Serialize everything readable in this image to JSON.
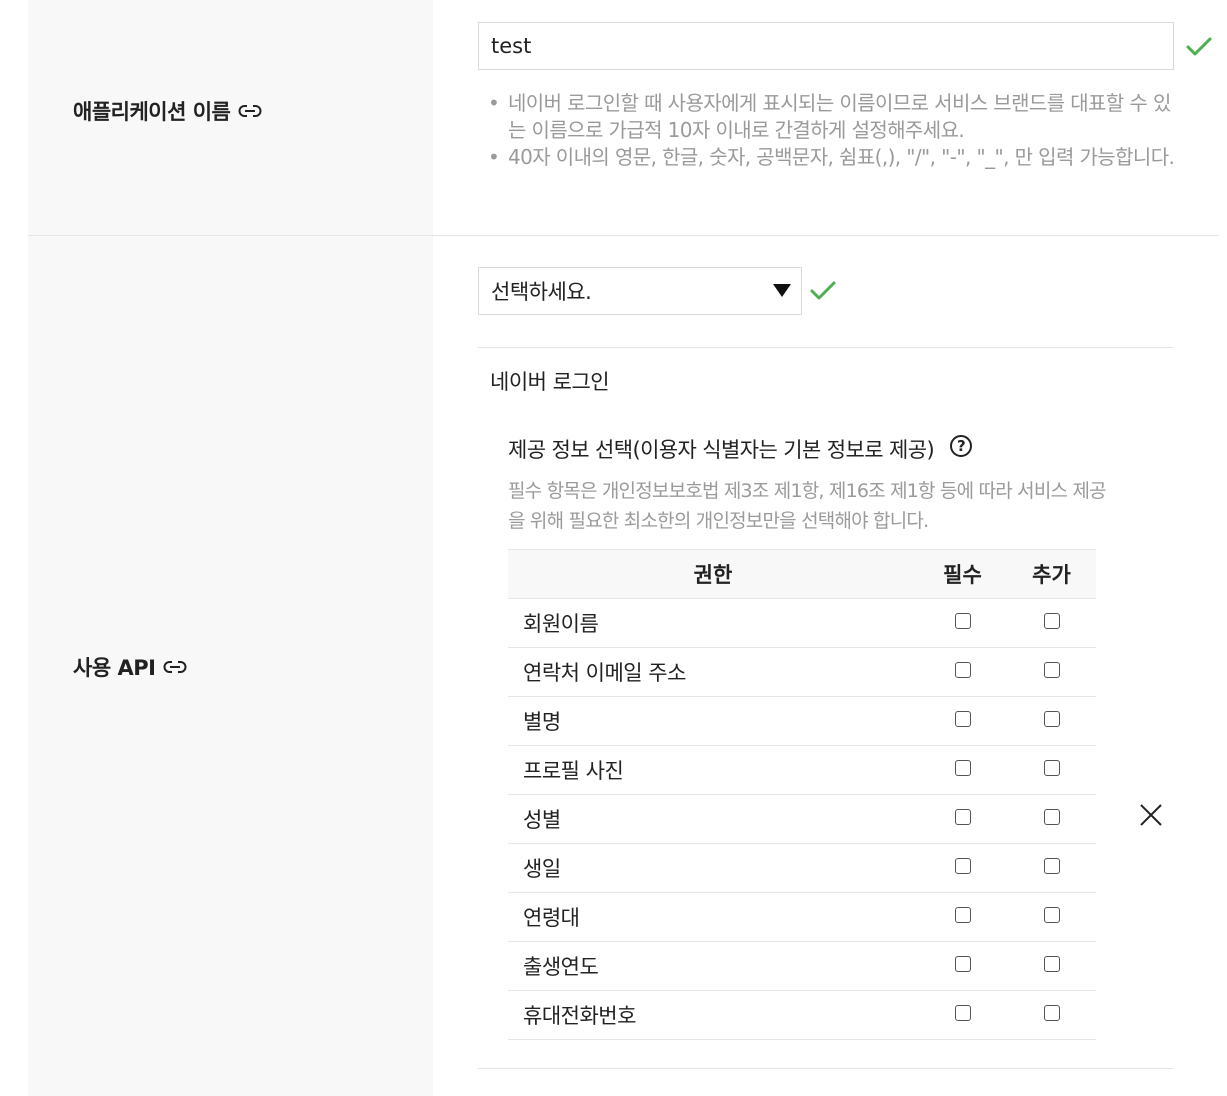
{
  "app_name_section": {
    "label": "애플리케이션 이름",
    "input_value": "test",
    "help": [
      "네이버 로그인할 때 사용자에게 표시되는 이름이므로 서비스 브랜드를 대표할 수 있는 이름으로 가급적 10자 이내로 간결하게 설정해주세요.",
      "40자 이내의 영문, 한글, 숫자, 공백문자, 쉼표(,), \"/\", \"-\", \"_\", 만 입력 가능합니다."
    ]
  },
  "api_section": {
    "label": "사용 API",
    "select_value": "선택하세요.",
    "api_name": "네이버 로그인",
    "provide_title": "제공 정보 선택(이용자 식별자는 기본 정보로 제공)",
    "help_symbol": "?",
    "provide_desc": "필수 항목은 개인정보보호법 제3조 제1항, 제16조 제1항 등에 따라 서비스 제공을 위해 필요한 최소한의 개인정보만을 선택해야 합니다.",
    "table": {
      "headers": [
        "권한",
        "필수",
        "추가"
      ],
      "rows": [
        "회원이름",
        "연락처 이메일 주소",
        "별명",
        "프로필 사진",
        "성별",
        "생일",
        "연령대",
        "출생연도",
        "휴대전화번호"
      ],
      "required_checked": [
        false,
        false,
        false,
        false,
        false,
        false,
        false,
        false,
        false
      ],
      "optional_checked": [
        false,
        false,
        false,
        false,
        false,
        false,
        false,
        false,
        false
      ]
    }
  },
  "icons": {
    "link": "link-icon",
    "check": "check-icon",
    "close": "close-icon",
    "dropdown": "caret-down-icon"
  },
  "colors": {
    "check_green": "#4caf50",
    "label_bg": "#f8f8f8",
    "help_text": "#9a9a9a"
  }
}
